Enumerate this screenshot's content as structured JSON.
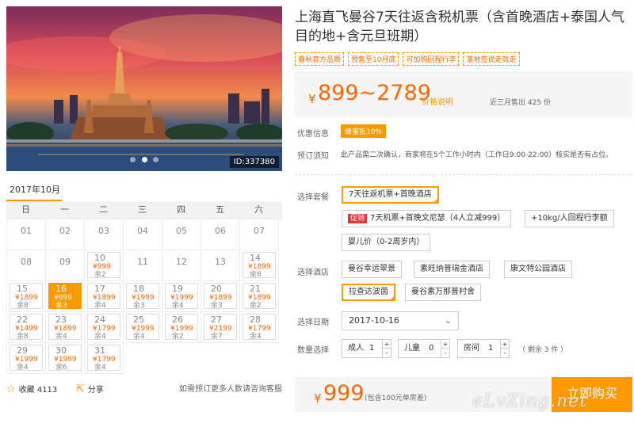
{
  "gallery": {
    "image_id": "ID:337380",
    "dots": 3,
    "active_dot": 1
  },
  "calendar": {
    "month": "2017年10月",
    "weekdays": [
      "日",
      "一",
      "二",
      "三",
      "四",
      "五",
      "六"
    ],
    "leading_blank": 0,
    "days": [
      {
        "d": "01"
      },
      {
        "d": "02"
      },
      {
        "d": "03"
      },
      {
        "d": "04"
      },
      {
        "d": "05"
      },
      {
        "d": "06"
      },
      {
        "d": "07"
      },
      {
        "d": "08"
      },
      {
        "d": "09"
      },
      {
        "d": "10",
        "p": "¥999",
        "l": "余2"
      },
      {
        "d": "11"
      },
      {
        "d": "12"
      },
      {
        "d": "13"
      },
      {
        "d": "14",
        "p": "¥1899",
        "l": "余8"
      },
      {
        "d": "15",
        "p": "¥1899",
        "l": "余8"
      },
      {
        "d": "16",
        "p": "¥899",
        "l": "余3",
        "sel": true
      },
      {
        "d": "17",
        "p": "¥1899",
        "l": "余4"
      },
      {
        "d": "18",
        "p": "¥1999",
        "l": "余3"
      },
      {
        "d": "19",
        "p": "¥1999",
        "l": "余4"
      },
      {
        "d": "20",
        "p": "¥1899",
        "l": "余3"
      },
      {
        "d": "21",
        "p": "¥1899",
        "l": "余2"
      },
      {
        "d": "22",
        "p": "¥1499",
        "l": "余8"
      },
      {
        "d": "23",
        "p": "¥1899",
        "l": "余4"
      },
      {
        "d": "24",
        "p": "¥1799",
        "l": "余4"
      },
      {
        "d": "25",
        "p": "¥1999",
        "l": "余4"
      },
      {
        "d": "26",
        "p": "¥1999",
        "l": "余2"
      },
      {
        "d": "27",
        "p": "¥2199",
        "l": "余7"
      },
      {
        "d": "28",
        "p": "¥1799",
        "l": "余4"
      },
      {
        "d": "29",
        "p": "¥1999",
        "l": "余4"
      },
      {
        "d": "30",
        "p": "¥1999",
        "l": "余6"
      },
      {
        "d": "31",
        "p": "¥1799",
        "l": "余4"
      }
    ]
  },
  "share_bar": {
    "favorite_label": "收藏 4113",
    "share_label": "分享",
    "note": "如需预订更多人数请咨询客服"
  },
  "product": {
    "title": "上海直飞曼谷7天往返含税机票（含首晚酒店+泰国人气目的地+含元旦班期）",
    "tags": [
      "春秋官方品质",
      "预售至10月底",
      "可加购回程行李",
      "落地签说走就走"
    ],
    "price_currency": "¥",
    "price_range": "899~2789",
    "price_explain": "价格说明",
    "sold_text": "近三月售出 425 份"
  },
  "promo": {
    "label": "优惠信息",
    "tag": "蜂蜜抵10%"
  },
  "notice": {
    "label": "预订须知",
    "text": "此产品需二次确认，商家将在5个工作小时内（工作日9:00-22:00）核实是否有占位。"
  },
  "package": {
    "label": "选择套餐",
    "options": [
      {
        "text": "7天往返机票+首晚酒店",
        "selected": true
      },
      {
        "hot": "促销",
        "text": "7天机票+首晚文尼瑟（4人立减999）"
      },
      {
        "text": "+10kg/人回程行李额"
      },
      {
        "text": "婴儿价（0-2周岁内）"
      }
    ]
  },
  "hotel": {
    "label": "选择酒店",
    "options": [
      {
        "text": "曼谷幸运翠景"
      },
      {
        "text": "素旺纳普瑞金酒店"
      },
      {
        "text": "康文特公园酒店"
      },
      {
        "text": "拉查达波茵",
        "selected": true
      },
      {
        "text": "曼谷素万那普村舍"
      }
    ]
  },
  "date": {
    "label": "选择日期",
    "value": "2017-10-16",
    "chevron": "chevron-down-icon"
  },
  "quantity": {
    "label": "数量选择",
    "adult_label": "成人",
    "adult_value": "1",
    "child_label": "儿童",
    "child_value": "0",
    "room_label": "房间",
    "room_value": "1",
    "remaining": "（ 剩余 3 件 ）"
  },
  "checkout": {
    "currency": "¥",
    "total": "999",
    "sub": "(包含100元单房差)",
    "buy_label": "立即购买"
  },
  "watermark": "eLvXing.net",
  "colors": {
    "accent": "#ff9900",
    "price": "#ff6600",
    "hot": "#e4393c"
  }
}
